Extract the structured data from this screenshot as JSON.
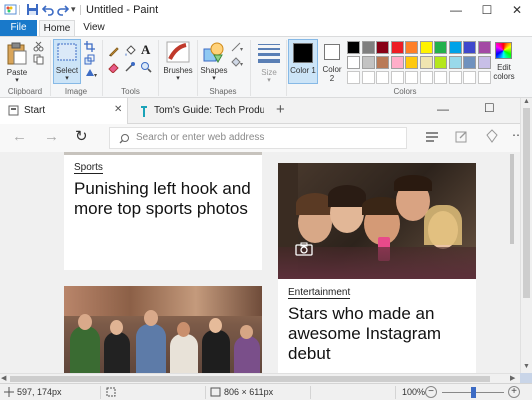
{
  "app": {
    "title": "Untitled - Paint"
  },
  "ribbon": {
    "tabs": [
      "File",
      "Home",
      "View"
    ],
    "clipboard": {
      "paste_label": "Paste",
      "group_label": "Clipboard"
    },
    "image": {
      "select_label": "Select",
      "group_label": "Image"
    },
    "tools": {
      "group_label": "Tools"
    },
    "brushes": {
      "label": "Brushes"
    },
    "shapes": {
      "label": "Shapes",
      "group_label": "Shapes"
    },
    "size": {
      "label": "Size"
    },
    "colors": {
      "color1_label": "Color 1",
      "color2_label": "Color 2",
      "group_label": "Colors",
      "edit_label": "Edit colors",
      "color1": "#000000",
      "color2": "#ffffff",
      "palette_row1": [
        "#000000",
        "#7f7f7f",
        "#880015",
        "#ed1c24",
        "#ff7f27",
        "#fff200",
        "#22b14c",
        "#00a2e8",
        "#3f48cc",
        "#a349a4"
      ],
      "palette_row2": [
        "#ffffff",
        "#c3c3c3",
        "#b97a57",
        "#ffaec9",
        "#ffc90e",
        "#efe4b0",
        "#b5e61d",
        "#99d9ea",
        "#7092be",
        "#c8bfe7"
      ]
    }
  },
  "browser": {
    "tab1": "Start",
    "tab2": "Tom's Guide: Tech Product R",
    "address_placeholder": "Search or enter web address"
  },
  "cards": {
    "sports": {
      "category": "Sports",
      "headline_line1": "Punishing left hook and",
      "headline_line2": "more top sports photos"
    },
    "entertainment": {
      "category": "Entertainment",
      "headline_line1": "Stars who made an",
      "headline_line2": "awesome Instagram",
      "headline_line3": "debut"
    }
  },
  "status": {
    "cursor_pos": "597, 174px",
    "canvas_size": "806 × 611px",
    "zoom": "100%"
  }
}
